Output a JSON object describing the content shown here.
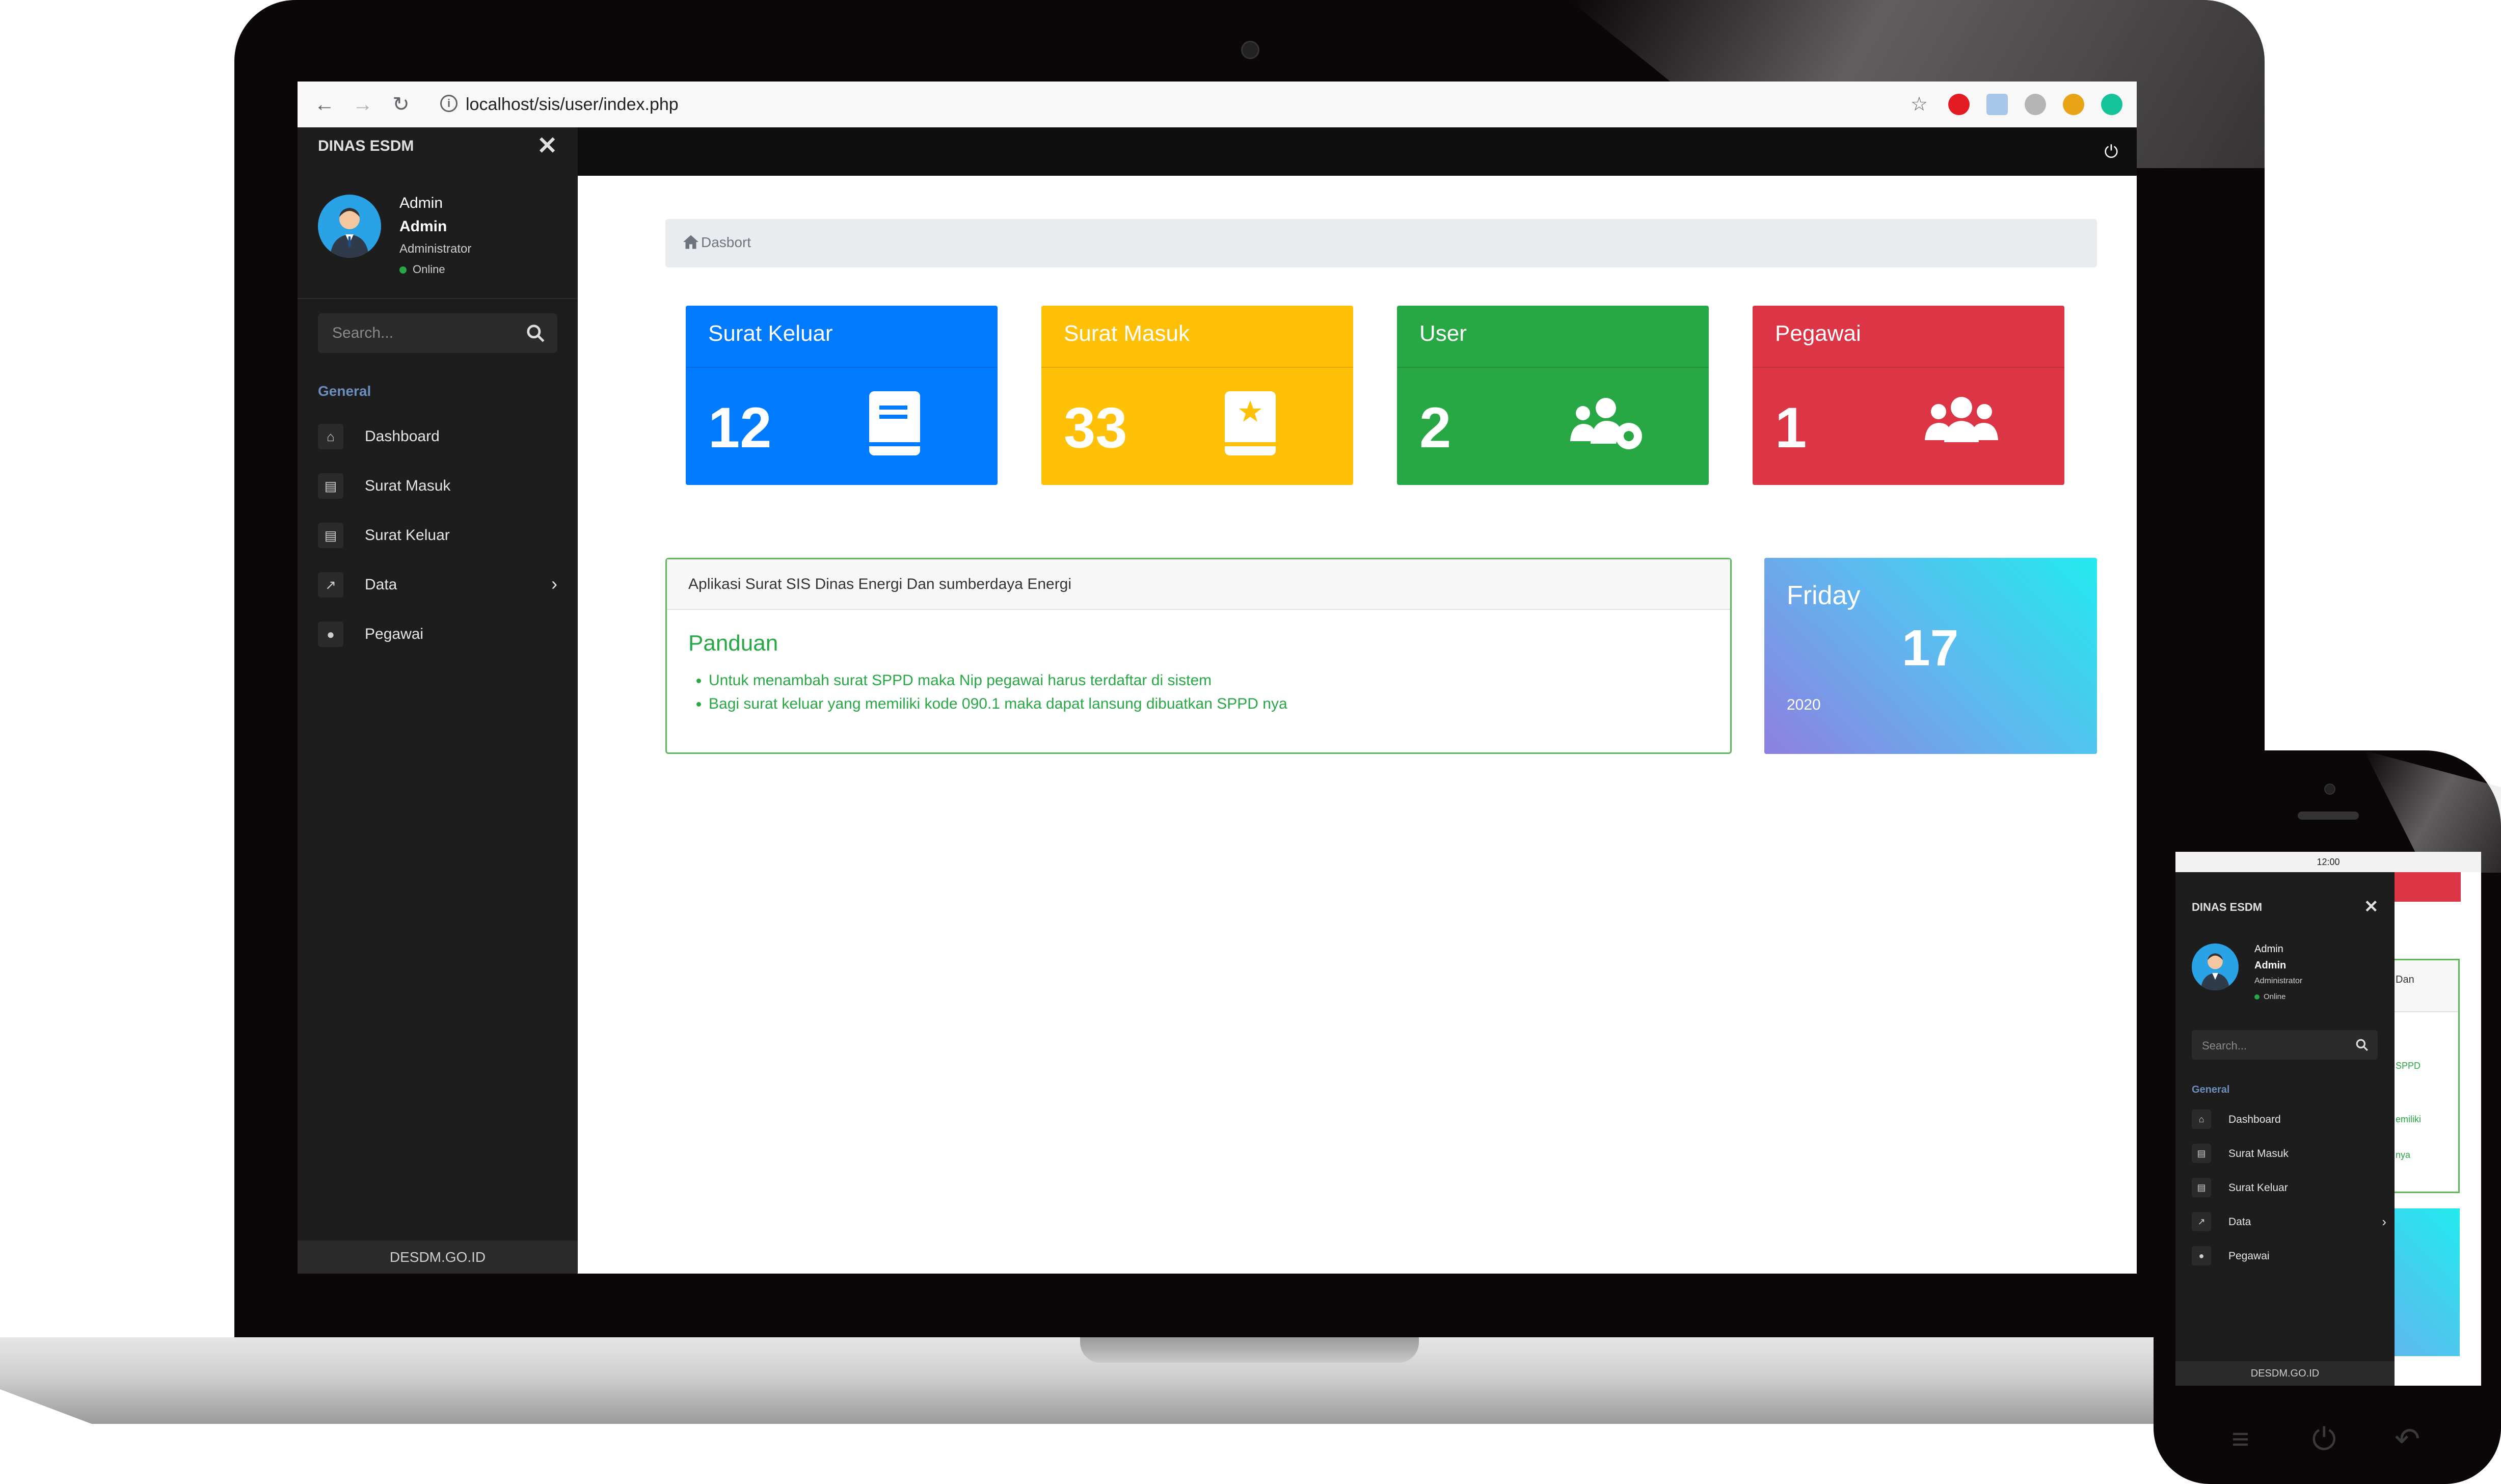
{
  "browser": {
    "url": "localhost/sis/user/index.php"
  },
  "sidebar": {
    "brand": "DINAS ESDM",
    "user": {
      "name_line1": "Admin",
      "name_line2": "Admin",
      "role": "Administrator",
      "status": "Online"
    },
    "search_placeholder": "Search...",
    "section_label": "General",
    "items": [
      {
        "label": "Dashboard",
        "icon": "home-icon"
      },
      {
        "label": "Surat Masuk",
        "icon": "book-icon"
      },
      {
        "label": "Surat Keluar",
        "icon": "book-icon"
      },
      {
        "label": "Data",
        "icon": "chart-icon",
        "has_submenu": true
      },
      {
        "label": "Pegawai",
        "icon": "users-icon"
      }
    ],
    "footer": "DESDM.GO.ID"
  },
  "breadcrumb": {
    "label": "Dasbort"
  },
  "cards": [
    {
      "title": "Surat Keluar",
      "value": "12",
      "color": "#007bff",
      "icon": "book-icon"
    },
    {
      "title": "Surat Masuk",
      "value": "33",
      "color": "#ffc107",
      "icon": "book-star-icon"
    },
    {
      "title": "User",
      "value": "2",
      "color": "#28a745",
      "icon": "users-cog-icon"
    },
    {
      "title": "Pegawai",
      "value": "1",
      "color": "#dc3545",
      "icon": "users-icon"
    }
  ],
  "info_panel": {
    "title": "Aplikasi Surat SIS Dinas Energi Dan sumberdaya Energi",
    "heading": "Panduan",
    "items": [
      "Untuk menambah surat SPPD maka Nip pegawai harus terdaftar di sistem",
      "Bagi surat keluar yang memiliki kode 090.1 maka dapat lansung dibuatkan SPPD nya"
    ]
  },
  "date_card": {
    "day": "Friday",
    "date": "17",
    "year": "2020"
  },
  "phone": {
    "time": "12:00",
    "brand": "DINAS ESDM",
    "user": {
      "name_line1": "Admin",
      "name_line2": "Admin",
      "role": "Administrator",
      "status": "Online"
    },
    "search_placeholder": "Search...",
    "section_label": "General",
    "items": [
      "Dashboard",
      "Surat Masuk",
      "Surat Keluar",
      "Data",
      "Pegawai"
    ],
    "footer": "DESDM.GO.ID",
    "peek": {
      "t1": "Dan",
      "t2": "SPPD",
      "t3": "emiliki",
      "t4": "nya"
    }
  }
}
